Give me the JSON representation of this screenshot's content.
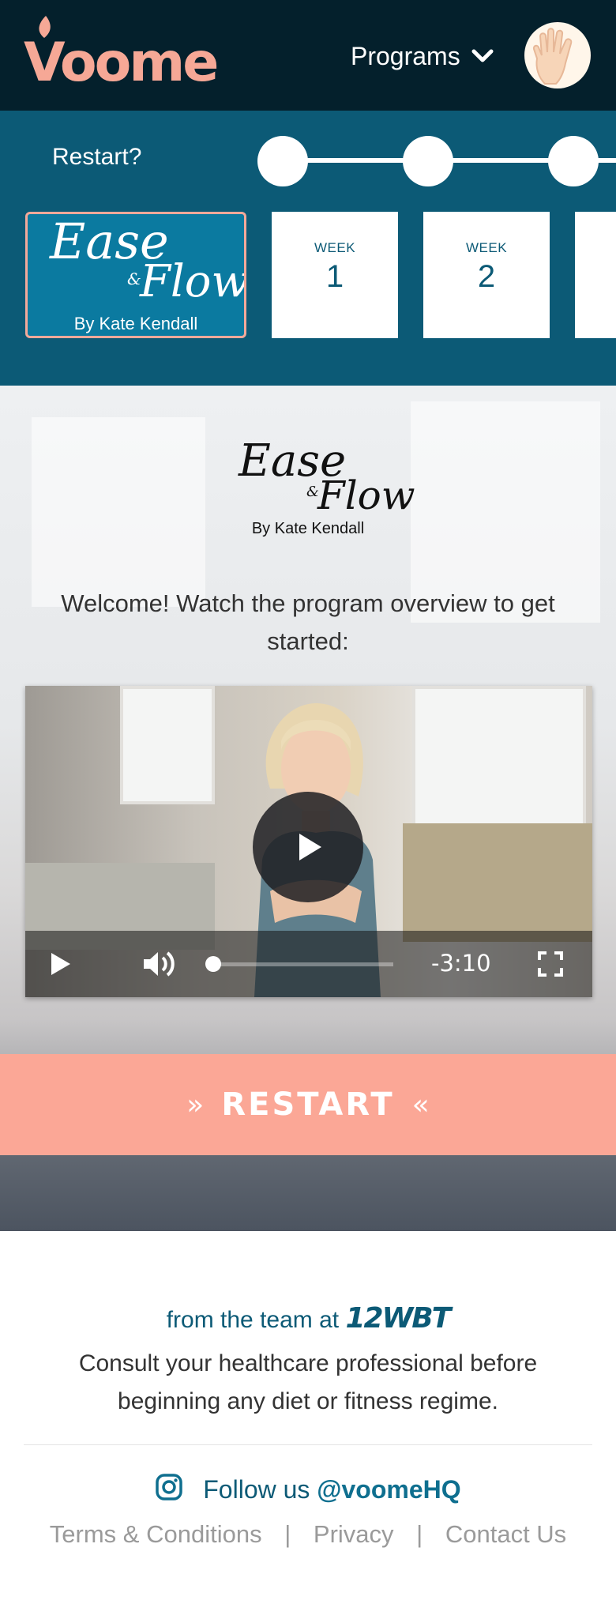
{
  "header": {
    "logo_text": "Voome",
    "programs_label": "Programs",
    "avatar_icon": "waving-hand-icon"
  },
  "nav": {
    "restart_label": "Restart?",
    "steps": 3,
    "program_card": {
      "title_line1": "Ease",
      "ampersand": "&",
      "title_line2": "Flow",
      "byline": "By Kate Kendall"
    },
    "weeks": [
      {
        "label": "WEEK",
        "number": "1"
      },
      {
        "label": "WEEK",
        "number": "2"
      }
    ]
  },
  "hero": {
    "logo": {
      "title_line1": "Ease",
      "ampersand": "&",
      "title_line2": "Flow",
      "byline": "By Kate Kendall"
    },
    "welcome_text": "Welcome! Watch the program overview to get started:",
    "video": {
      "time_remaining": "-3:10",
      "progress": 0.0,
      "icons": [
        "play-icon",
        "volume-icon",
        "fullscreen-icon"
      ]
    },
    "restart_button": {
      "left_arrows": "»",
      "label": "RESTART",
      "right_arrows": "«"
    }
  },
  "footer": {
    "team_prefix": "from the team at",
    "team_brand": "12WBT",
    "disclaimer": "Consult your healthcare professional before beginning any diet or fitness regime.",
    "follow_prefix": "Follow us",
    "follow_handle": "@voomeHQ",
    "links": [
      {
        "label": "Terms & Conditions"
      },
      {
        "label": "Privacy"
      },
      {
        "label": "Contact Us"
      }
    ],
    "separator": "|"
  },
  "colors": {
    "header_bg": "#04202c",
    "band_bg": "#0c5a76",
    "accent": "#fba796",
    "brand_teal": "#0c5a76"
  }
}
